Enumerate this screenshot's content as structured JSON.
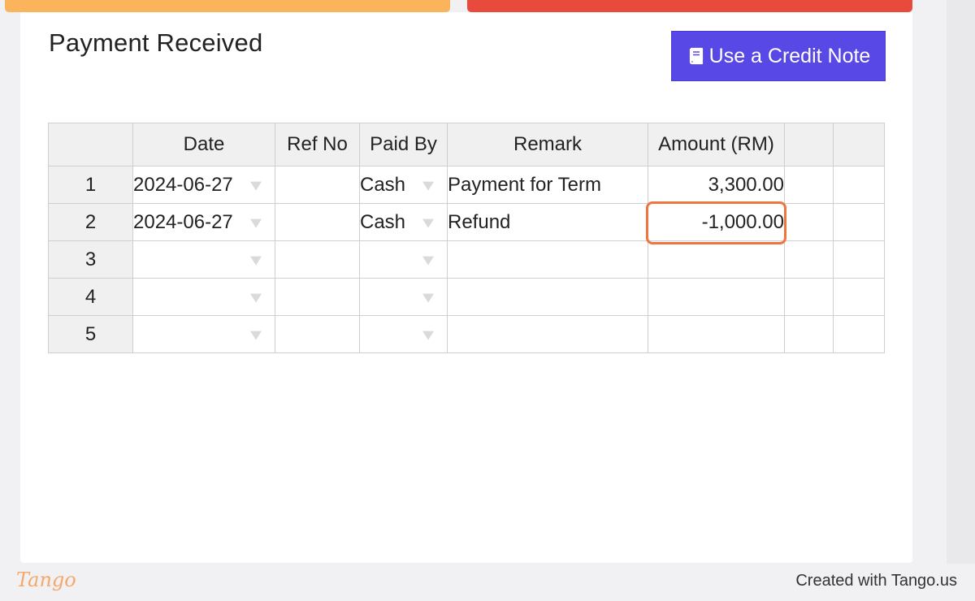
{
  "panel": {
    "title": "Payment Received",
    "credit_button_label": "Use a Credit Note"
  },
  "table": {
    "headers": [
      "",
      "Date",
      "Ref No",
      "Paid By",
      "Remark",
      "Amount (RM)",
      "",
      ""
    ],
    "rows": [
      {
        "num": "1",
        "date": "2024-06-27",
        "ref": "",
        "paid_by": "Cash",
        "remark": "Payment for Term",
        "amount": "3,300.00"
      },
      {
        "num": "2",
        "date": "2024-06-27",
        "ref": "",
        "paid_by": "Cash",
        "remark": "Refund",
        "amount": "-1,000.00"
      },
      {
        "num": "3",
        "date": "",
        "ref": "",
        "paid_by": "",
        "remark": "",
        "amount": ""
      },
      {
        "num": "4",
        "date": "",
        "ref": "",
        "paid_by": "",
        "remark": "",
        "amount": ""
      },
      {
        "num": "5",
        "date": "",
        "ref": "",
        "paid_by": "",
        "remark": "",
        "amount": ""
      }
    ],
    "highlighted_cell": "rows.1.amount"
  },
  "footer": {
    "brand": "Tango",
    "credit": "Created with Tango.us"
  },
  "colors": {
    "accent_orange": "#fbb45c",
    "accent_red": "#e84b3c",
    "button_purple": "#5848e6",
    "highlight": "#f0743e"
  },
  "icons": {
    "credit_button": "book-icon",
    "dropdown": "dropdown-arrow-icon"
  }
}
